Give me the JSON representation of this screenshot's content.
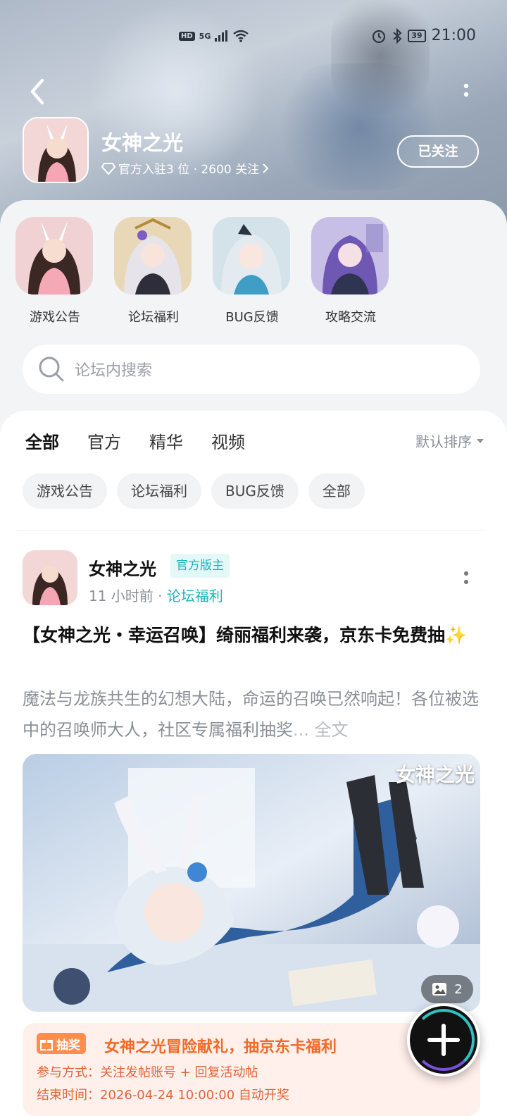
{
  "status_bar": {
    "hd": "HD",
    "net": "5G",
    "battery": "39",
    "time": "21:00"
  },
  "header": {
    "forum_name": "女神之光",
    "meta": "官方入驻3 位 · 2600 关注",
    "follow_label": "已关注"
  },
  "shortcuts": [
    {
      "label": "游戏公告"
    },
    {
      "label": "论坛福利"
    },
    {
      "label": "BUG反馈"
    },
    {
      "label": "攻略交流"
    }
  ],
  "search": {
    "placeholder": "论坛内搜索"
  },
  "tabs": [
    "全部",
    "官方",
    "精华",
    "视频"
  ],
  "sort_label": "默认排序",
  "chips": [
    "游戏公告",
    "论坛福利",
    "BUG反馈",
    "全部"
  ],
  "post": {
    "author": "女神之光",
    "role_tag": "官方版主",
    "time": "11 小时前",
    "board": "论坛福利",
    "title": "【女神之光・幸运召唤】绮丽福利来袭，京东卡免费抽",
    "title_emoji": "✨",
    "body": "魔法与龙族共生的幻想大陆，命运的召唤已然响起！各位被选中的召唤师大人，社区专属福利抽奖",
    "more_label": "... 全文",
    "image_watermark": "女神之光",
    "image_count": "2"
  },
  "lottery": {
    "badge": "抽奖",
    "title": "女神之光冒险献礼，抽京东卡福利",
    "join": "参与方式：关注发帖账号 + 回复活动帖",
    "end": "结束时间：2026-04-24 10:00:00 自动开奖"
  },
  "colors": {
    "accent": "#22c4c6",
    "lottery": "#f06a28"
  }
}
